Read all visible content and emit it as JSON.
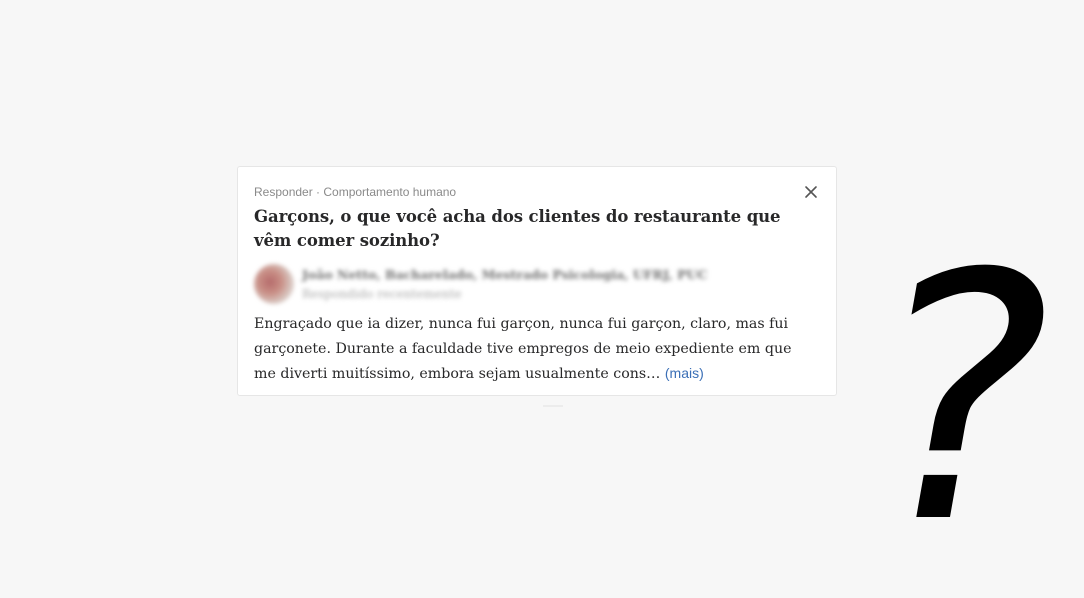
{
  "card": {
    "meta": "Responder · Comportamento humano",
    "question": "Garçons, o que você acha dos clientes do restaurante que vêm comer sozinho?",
    "author_name": "João Netto, Bacharelado, Mestrado Psicologia, UFRJ, PUC",
    "author_credential": "Respondido recentemente",
    "answer_text": "Engraçado que ia dizer, nunca fui garçon, nunca fui garçon, claro, mas fui garçonete. Durante a faculdade tive empregos de meio expediente em que me diverti muitíssimo, embora sejam usualmente cons…",
    "more_label": "(mais)",
    "close_icon": "close-icon"
  },
  "overlay": {
    "question_mark": "?"
  }
}
